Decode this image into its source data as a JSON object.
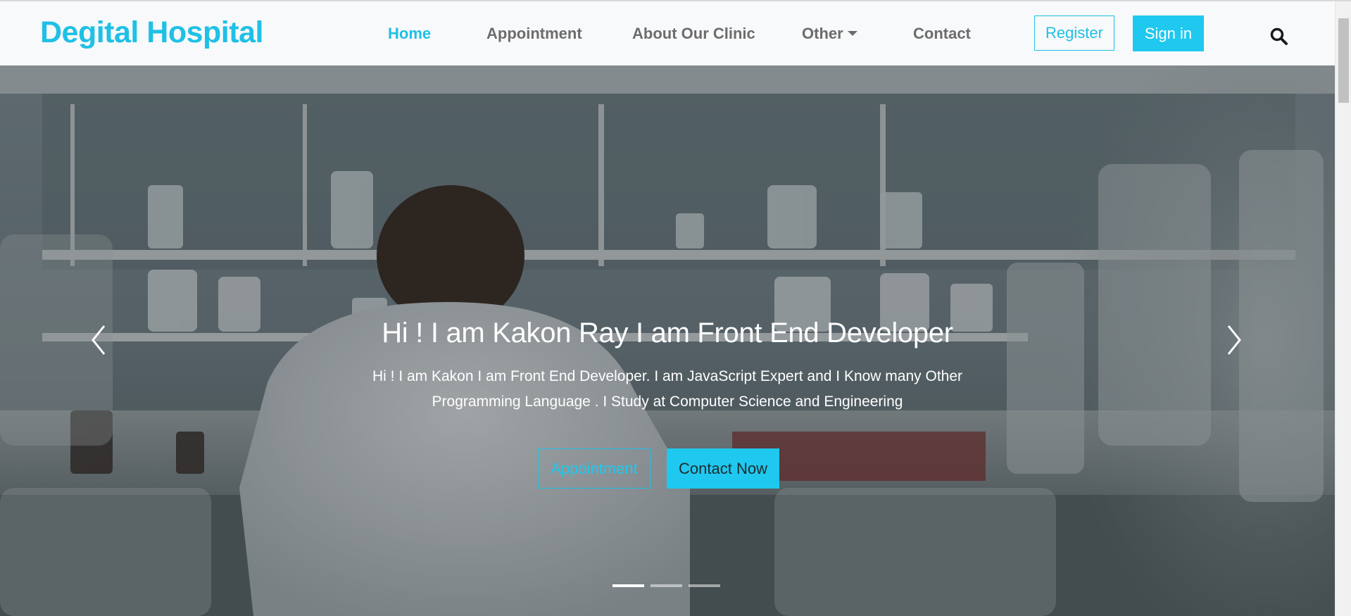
{
  "navbar": {
    "brand": "Degital Hospital",
    "links": [
      {
        "label": "Home",
        "active": true
      },
      {
        "label": "Appointment",
        "active": false
      },
      {
        "label": "About Our Clinic",
        "active": false
      },
      {
        "label": "Other",
        "active": false,
        "dropdown": true
      },
      {
        "label": "Contact",
        "active": false
      }
    ],
    "register_label": "Register",
    "signin_label": "Sign in",
    "search_icon": "search-icon"
  },
  "hero": {
    "title": "Hi ! I am Kakon Ray I am Front End Developer",
    "text": "Hi ! I am Kakon I am Front End Developer. I am JavaScript Expert and I Know many Other Programming Language . I Study at Computer Science and Engineering",
    "appointment_label": "Appointment",
    "contact_label": "Contact Now",
    "prev_icon": "chevron-left-icon",
    "next_icon": "chevron-right-icon",
    "slide_count": 3,
    "active_slide": 1
  },
  "colors": {
    "accent": "#1fc0e6",
    "nav_text": "#6c6c6c",
    "navbar_bg": "#f8f9fa"
  }
}
